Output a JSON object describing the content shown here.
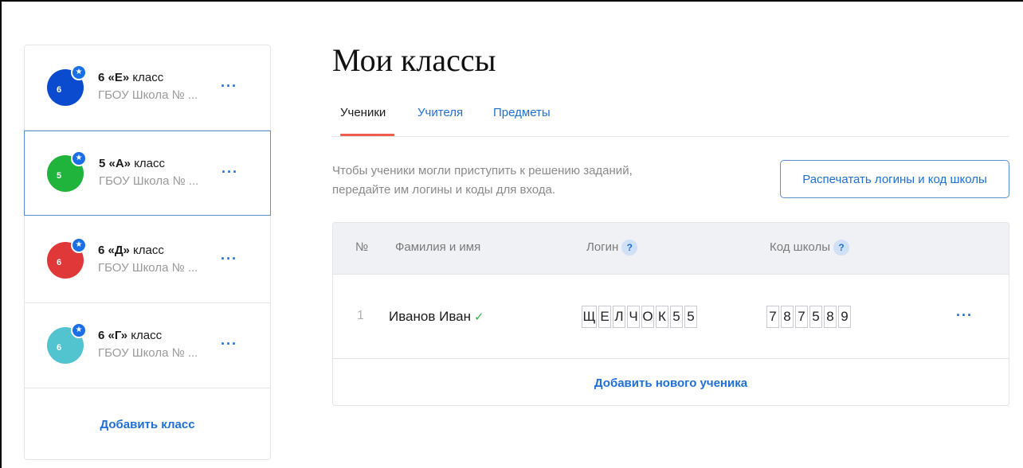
{
  "sidebar": {
    "classes": [
      {
        "avatar_num": "6",
        "grade": "6 «Е»",
        "suffix": " класс",
        "school": "ГБОУ Школа № ...",
        "color": "#0b4bcf",
        "selected": false
      },
      {
        "avatar_num": "5",
        "grade": "5 «А»",
        "suffix": " класс",
        "school": "ГБОУ Школа № ...",
        "color": "#20b43c",
        "selected": true
      },
      {
        "avatar_num": "6",
        "grade": "6 «Д»",
        "suffix": " класс",
        "school": "ГБОУ Школа № ...",
        "color": "#e03838",
        "selected": false
      },
      {
        "avatar_num": "6",
        "grade": "6 «Г»",
        "suffix": " класс",
        "school": "ГБОУ Школа № ...",
        "color": "#52c4cf",
        "selected": false
      }
    ],
    "star_glyph": "★",
    "more_glyph": "···",
    "add_class_label": "Добавить класс"
  },
  "main": {
    "title": "Мои классы",
    "tabs": [
      {
        "label": "Ученики",
        "active": true
      },
      {
        "label": "Учителя",
        "active": false
      },
      {
        "label": "Предметы",
        "active": false
      }
    ],
    "hint": "Чтобы ученики могли приступить к решению заданий, передайте им логины и коды для входа.",
    "print_button": "Распечатать логины и код школы"
  },
  "table": {
    "headers": {
      "num": "№",
      "name": "Фамилия и имя",
      "login": "Логин",
      "code": "Код школы",
      "help": "?"
    },
    "rows": [
      {
        "num": "1",
        "name": "Иванов Иван",
        "verified_glyph": "✓",
        "login": [
          "Щ",
          "Е",
          "Л",
          "Ч",
          "О",
          "К",
          "5",
          "5"
        ],
        "code": [
          "7",
          "8",
          "7",
          "5",
          "8",
          "9"
        ]
      }
    ],
    "add_student_label": "Добавить нового ученика",
    "row_more_glyph": "···"
  },
  "colors": {
    "accent": "#1f6fd9",
    "tab_underline": "#ef5b4c",
    "check": "#39b44a"
  }
}
